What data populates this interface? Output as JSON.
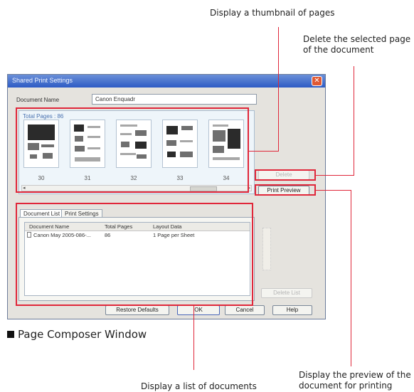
{
  "annotations": {
    "thumbnail": "Display a thumbnail of pages",
    "delete_line1": "Delete the selected page",
    "delete_line2": "of the document",
    "list": "Display a list of documents",
    "preview_line1": "Display the preview of the",
    "preview_line2": "document for printing",
    "caption": "Page Composer Window"
  },
  "window": {
    "title": "Shared Print Settings",
    "document_name_label": "Document Name",
    "document_name_value": "Canon Enquadr",
    "total_pages_label": "Total Pages : 86",
    "thumbnails": [
      {
        "page": "30"
      },
      {
        "page": "31"
      },
      {
        "page": "32"
      },
      {
        "page": "33"
      },
      {
        "page": "34"
      }
    ],
    "buttons": {
      "delete": "Delete",
      "print_preview": "Print Preview",
      "restore_defaults": "Restore Defaults",
      "ok": "OK",
      "cancel": "Cancel",
      "help": "Help",
      "delete_list": "Delete List"
    },
    "tabs": [
      "Document List",
      "Print Settings"
    ],
    "list": {
      "headers": [
        "Document Name",
        "Total Pages",
        "Layout Data"
      ],
      "rows": [
        {
          "name": "Canon May 2005-086-...",
          "pages": "86",
          "layout": "1 Page per Sheet"
        }
      ]
    }
  },
  "colors": {
    "callout_line": "#e0273a",
    "titlebar": "#2d5bc4"
  }
}
